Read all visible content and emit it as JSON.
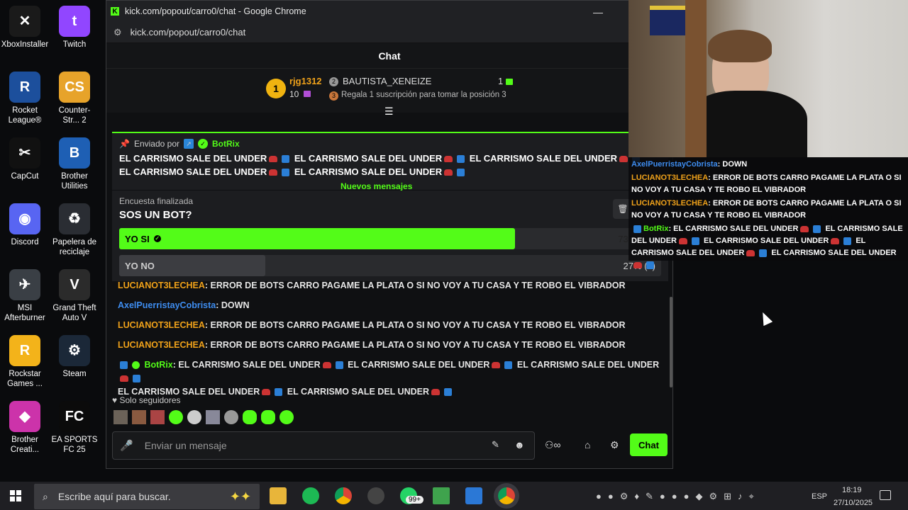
{
  "desktop": {
    "icons": [
      {
        "label": "XboxInstaller",
        "color": "#1a1a1a",
        "glyph": "✕"
      },
      {
        "label": "Twitch",
        "color": "#9146ff",
        "glyph": "t"
      },
      {
        "label": "Rocket League®",
        "color": "#1c4f9c",
        "glyph": "R"
      },
      {
        "label": "Counter-Str... 2",
        "color": "#e7a32a",
        "glyph": "CS"
      },
      {
        "label": "CapCut",
        "color": "#111",
        "glyph": "✂"
      },
      {
        "label": "Brother Utilities",
        "color": "#1e5fb4",
        "glyph": "B"
      },
      {
        "label": "Discord",
        "color": "#5865f2",
        "glyph": "◉"
      },
      {
        "label": "Papelera de reciclaje",
        "color": "#2a2d33",
        "glyph": "♻"
      },
      {
        "label": "MSI Afterburner",
        "color": "#3a3f45",
        "glyph": "✈"
      },
      {
        "label": "Grand Theft Auto V",
        "color": "#2b2b2b",
        "glyph": "V"
      },
      {
        "label": "Rockstar Games ...",
        "color": "#f3b31a",
        "glyph": "R"
      },
      {
        "label": "Steam",
        "color": "#1b2838",
        "glyph": "⚙"
      },
      {
        "label": "Brother Creati...",
        "color": "#c3a",
        "glyph": "◆"
      },
      {
        "label": "EA SPORTS FC 25",
        "color": "#0b0b0b",
        "glyph": "FC"
      }
    ]
  },
  "browser": {
    "title": "kick.com/popout/carro0/chat - Google Chrome",
    "url": "kick.com/popout/carro0/chat",
    "minimize": "—"
  },
  "chat": {
    "header": "Chat",
    "leader": {
      "rank": "1",
      "user1": "rjg1312",
      "user1_count": "10",
      "user2": "BAUTISTA_XENEIZE",
      "user2_count": "1",
      "rank3_badge": "3",
      "hint": "Regala 1 suscripción para tomar la posición 3"
    },
    "pinned": {
      "by_label": "Enviado por",
      "by_user": "BotRix",
      "line1": "EL CARRISMO SALE DEL UNDER",
      "line2": "EL CARRISMO SALE DEL UNDER",
      "line3": "EL CARRISMO SALE DEL UNDER",
      "line4": "EL CARRISMO SALE DEL UNDER",
      "line5": "EL CARRISMO SALE DEL UNDER"
    },
    "new_messages": "Nuevos mensajes",
    "poll": {
      "status": "Encuesta finalizada",
      "question": "SOS UN BOT?",
      "options": [
        {
          "label": "YO SI",
          "result": "73% (16)",
          "fraction": 0.73
        },
        {
          "label": "YO NO",
          "result": "27% (6)",
          "fraction": 0.27
        }
      ]
    },
    "messages": [
      {
        "user": "LUCIANOT3LECHEA",
        "text": ": ERROR DE BOTS CARRO PAGAME LA PLATA O SI NO VOY A TU CASA Y TE ROBO EL VIBRADOR"
      },
      {
        "user": "AxelPuerristayCobrista",
        "text": ": DOWN"
      },
      {
        "user": "LUCIANOT3LECHEA",
        "text": ": ERROR DE BOTS CARRO PAGAME LA PLATA O SI NO VOY A TU CASA Y TE ROBO EL VIBRADOR"
      },
      {
        "user": "LUCIANOT3LECHEA",
        "text": ": ERROR DE BOTS CARRO PAGAME LA PLATA O SI NO VOY A TU CASA Y TE ROBO EL VIBRADOR"
      }
    ],
    "bot_message": {
      "user": "BotRix",
      "part": "EL CARRISMO SALE DEL UNDER"
    },
    "followers_only": "Solo seguidores",
    "composer_placeholder": "Enviar un mensaje",
    "send_label": "Chat"
  },
  "overlay": {
    "lines": [
      {
        "user": "AxelPuerristayCobrista",
        "text": ": DOWN"
      },
      {
        "user": "LUCIANOT3LECHEA",
        "text": ": ERROR DE BOTS CARRO PAGAME LA PLATA O SI NO VOY A TU CASA Y TE ROBO EL VIBRADOR"
      },
      {
        "user": "LUCIANOT3LECHEA",
        "text": ": ERROR DE BOTS CARRO PAGAME LA PLATA O SI NO VOY A TU CASA Y TE ROBO EL VIBRADOR"
      },
      {
        "user": "BotRix",
        "text": ": EL CARRISMO SALE DEL UNDER"
      }
    ],
    "bot_part": "EL CARRISMO SALE DEL UNDER"
  },
  "taskbar": {
    "search_placeholder": "Escribe aquí para buscar.",
    "badge": "99+",
    "lang": "ESP",
    "time": "18:19",
    "date": "27/10/2025"
  },
  "colors": {
    "kick_green": "#53fc18",
    "user_orange": "#f0a21a",
    "user_blue": "#3e8df0"
  }
}
